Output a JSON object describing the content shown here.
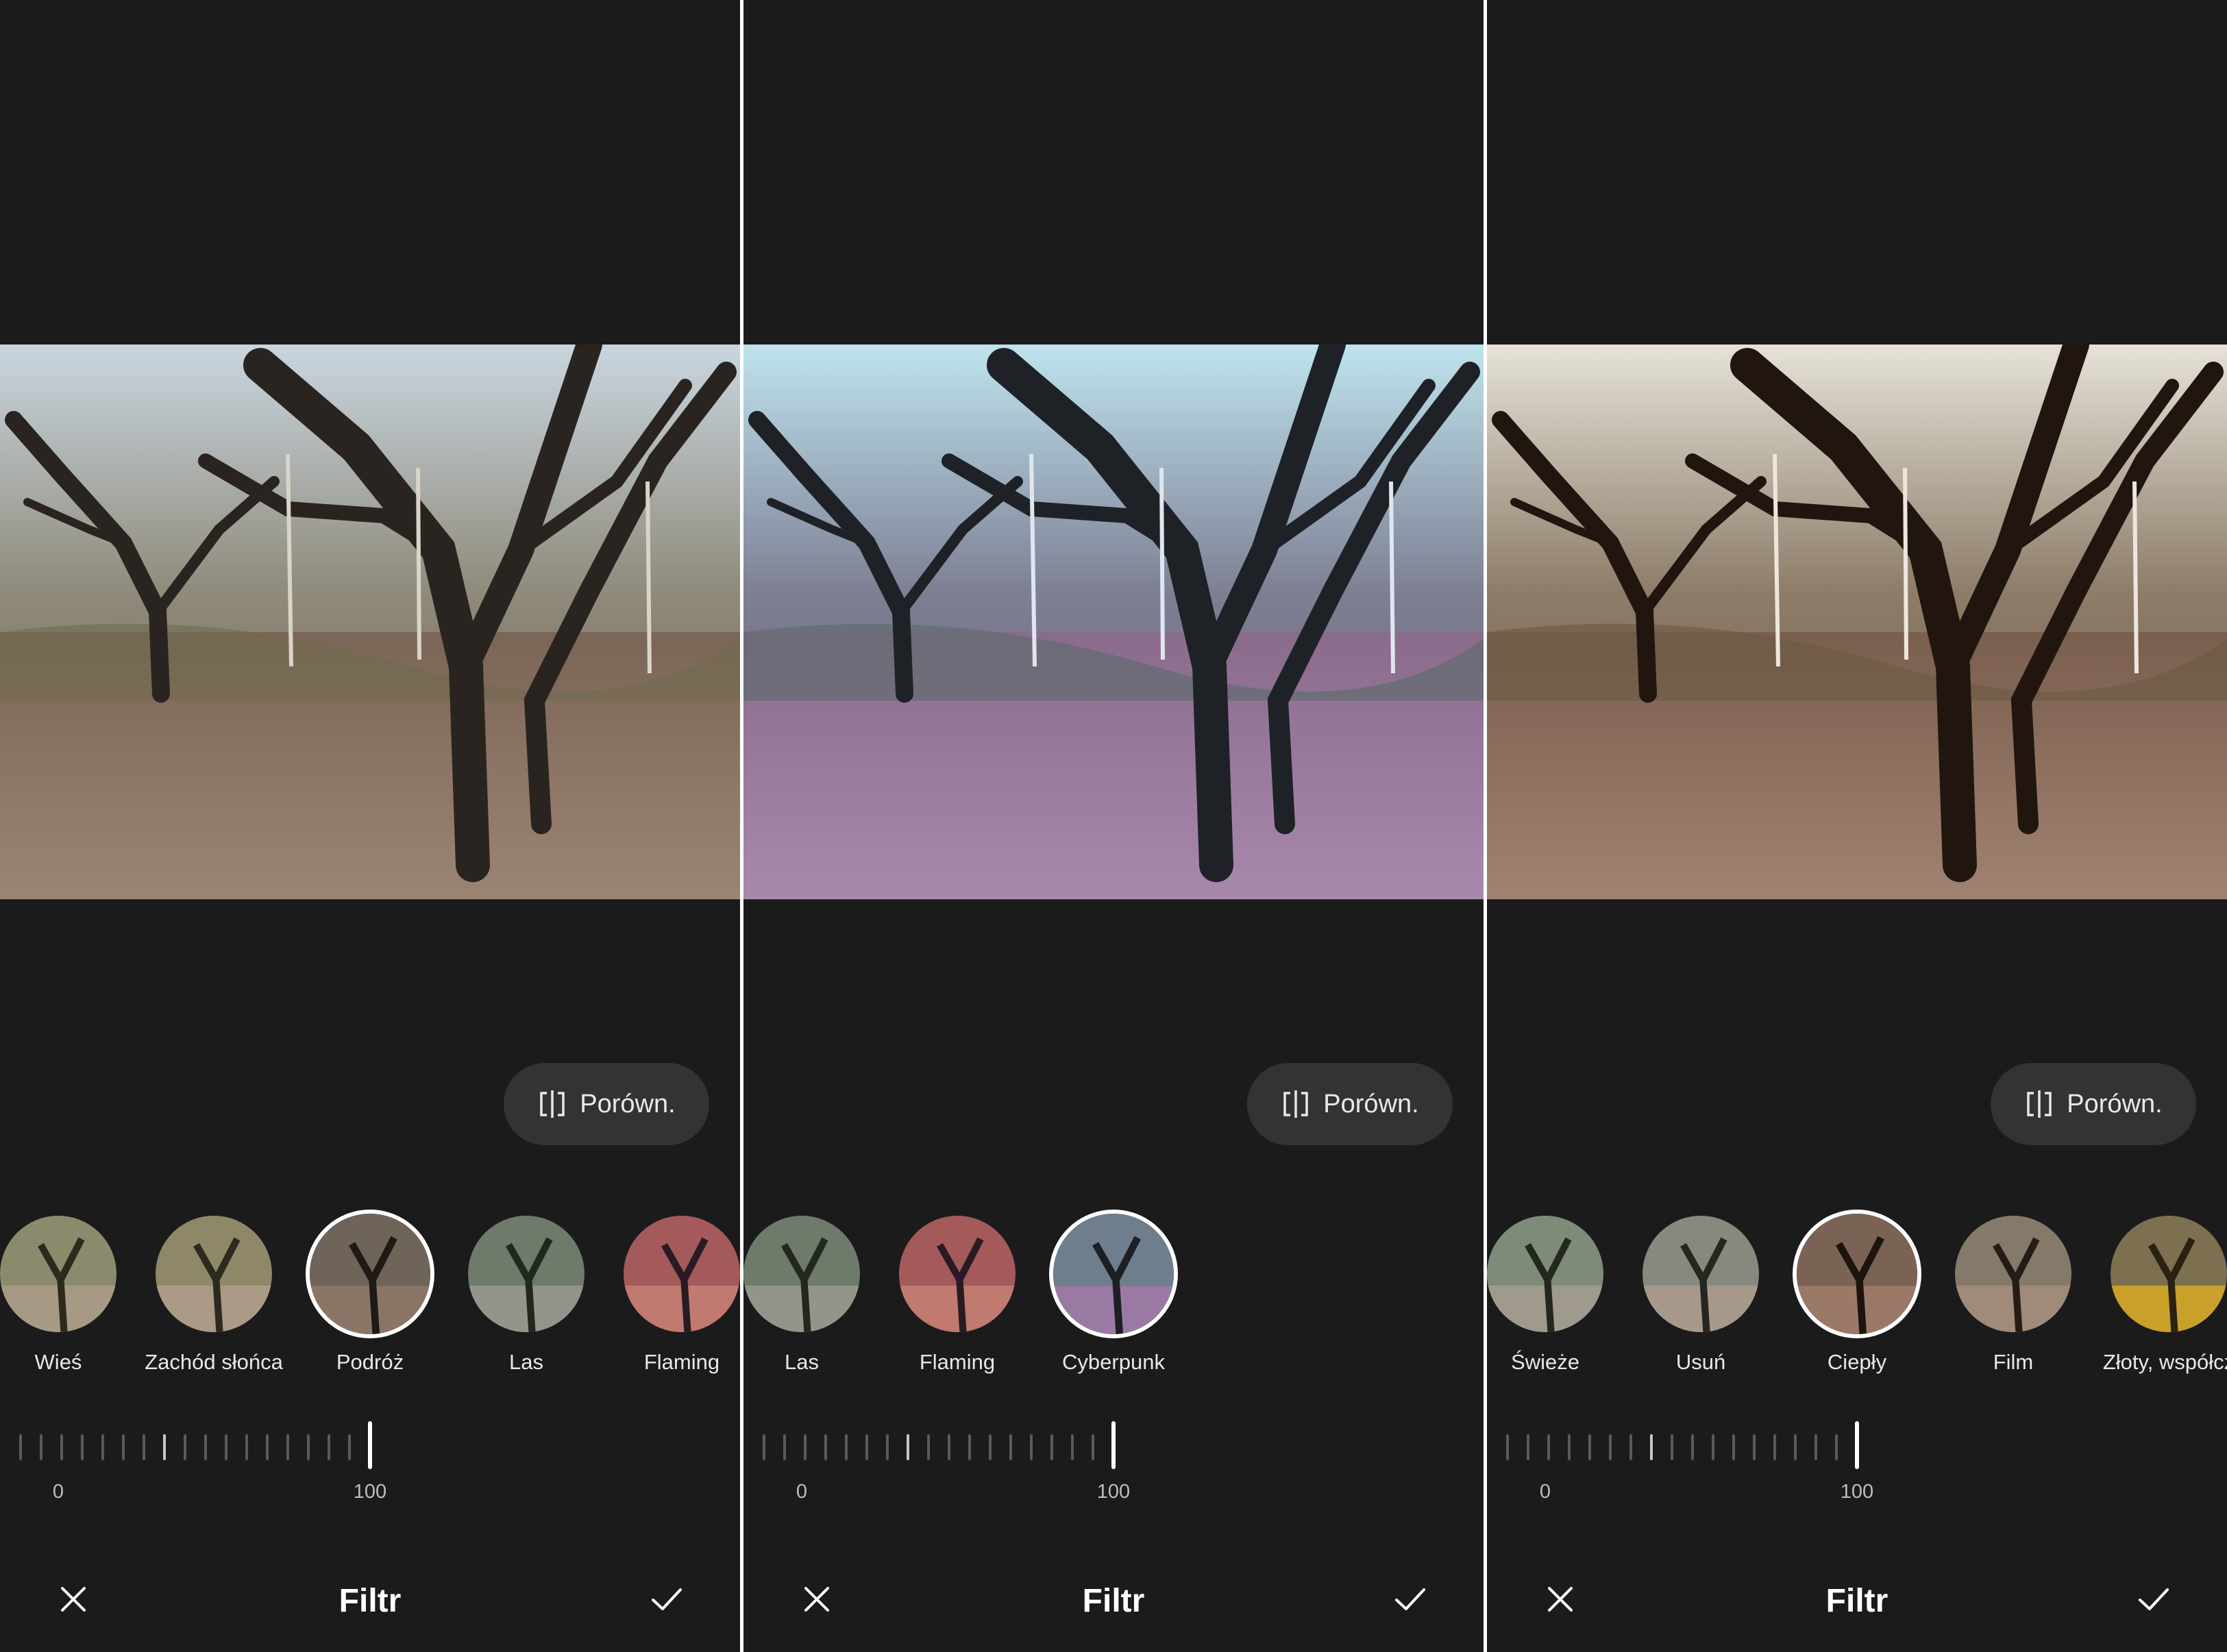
{
  "panels": [
    {
      "filters": [
        {
          "label": "Wieś"
        },
        {
          "label": "Zachód słońca"
        },
        {
          "label": "Podróż"
        },
        {
          "label": "Las"
        },
        {
          "label": "Flaming"
        }
      ],
      "selected_filter": "Podróż",
      "compare_label": "Porówn.",
      "slider": {
        "min_label": "0",
        "max_label": "100",
        "value": 100
      },
      "title": "Filtr",
      "photo_tint": "#8a6f5f"
    },
    {
      "filters": [
        {
          "label": "Las"
        },
        {
          "label": "Flaming"
        },
        {
          "label": "Cyberpunk"
        }
      ],
      "selected_filter": "Cyberpunk",
      "compare_label": "Porówn.",
      "slider": {
        "min_label": "0",
        "max_label": "100",
        "value": 100
      },
      "title": "Filtr",
      "photo_tint": "#9a6fa0"
    },
    {
      "filters": [
        {
          "label": "Świeże"
        },
        {
          "label": "Usuń"
        },
        {
          "label": "Ciepły"
        },
        {
          "label": "Film"
        },
        {
          "label": "Złoty, współcz"
        }
      ],
      "selected_filter": "Ciepły",
      "compare_label": "Porówn.",
      "slider": {
        "min_label": "0",
        "max_label": "100",
        "value": 100
      },
      "title": "Filtr",
      "photo_tint": "#8c6a55"
    }
  ],
  "icons": {
    "compare": "compare-icon",
    "cancel": "close-icon",
    "confirm": "check-icon"
  },
  "colors": {
    "background": "#1b1b1c",
    "button_bg": "#333335",
    "accent": "#ffffff"
  }
}
